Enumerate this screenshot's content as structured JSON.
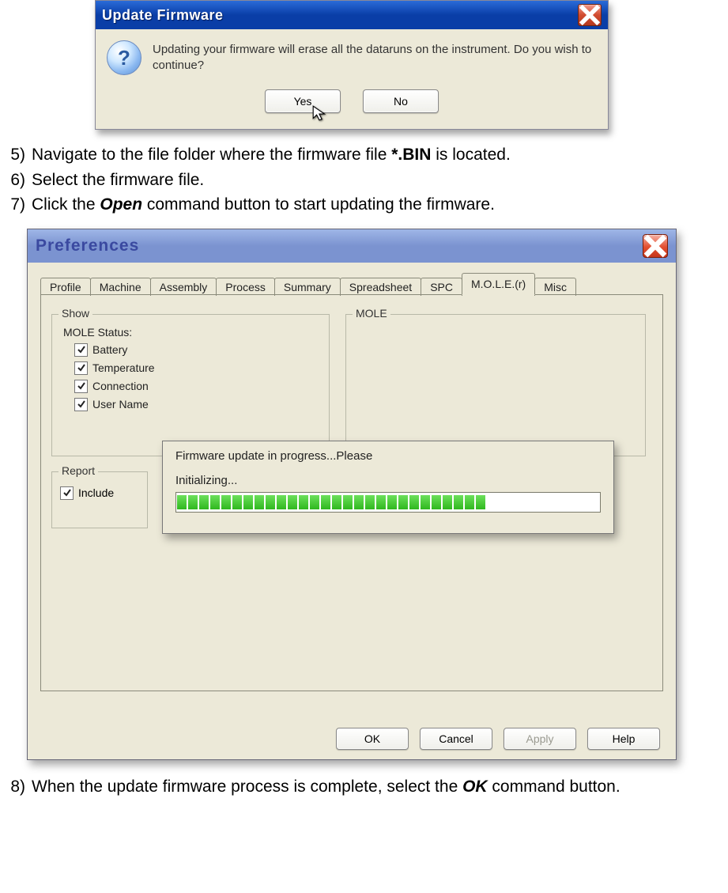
{
  "dialog1": {
    "title": "Update Firmware",
    "message": "Updating your firmware will erase all the dataruns on the instrument. Do you wish to continue?",
    "yes": "Yes",
    "no": "No"
  },
  "steps": {
    "s5": {
      "num": "5)",
      "pre": "Navigate to the file folder where the firmware file ",
      "bold": "*.BIN",
      "post": " is located."
    },
    "s6": {
      "num": "6)",
      "text": "Select the firmware file."
    },
    "s7": {
      "num": "7)",
      "pre": "Click the ",
      "bi": "Open",
      "post": " command button to start updating the firmware."
    },
    "s8": {
      "num": "8)",
      "pre": "When the update firmware process is complete, select the ",
      "bi": "OK",
      "post": " command button."
    }
  },
  "dialog2": {
    "title": "Preferences",
    "tabs": [
      "Profile",
      "Machine",
      "Assembly",
      "Process",
      "Summary",
      "Spreadsheet",
      "SPC",
      "M.O.L.E.(r)",
      "Misc"
    ],
    "active_tab_index": 7,
    "show": {
      "legend": "Show",
      "status_label": "MOLE Status:",
      "items": [
        "Battery",
        "Temperature",
        "Connection",
        "User Name"
      ]
    },
    "mole_legend": "MOLE",
    "report": {
      "legend": "Report",
      "include": "Include"
    },
    "progress": {
      "line1": "Firmware update in progress...Please",
      "line2": "Initializing...",
      "segments": 28
    },
    "buttons": {
      "ok": "OK",
      "cancel": "Cancel",
      "apply": "Apply",
      "help": "Help"
    }
  }
}
